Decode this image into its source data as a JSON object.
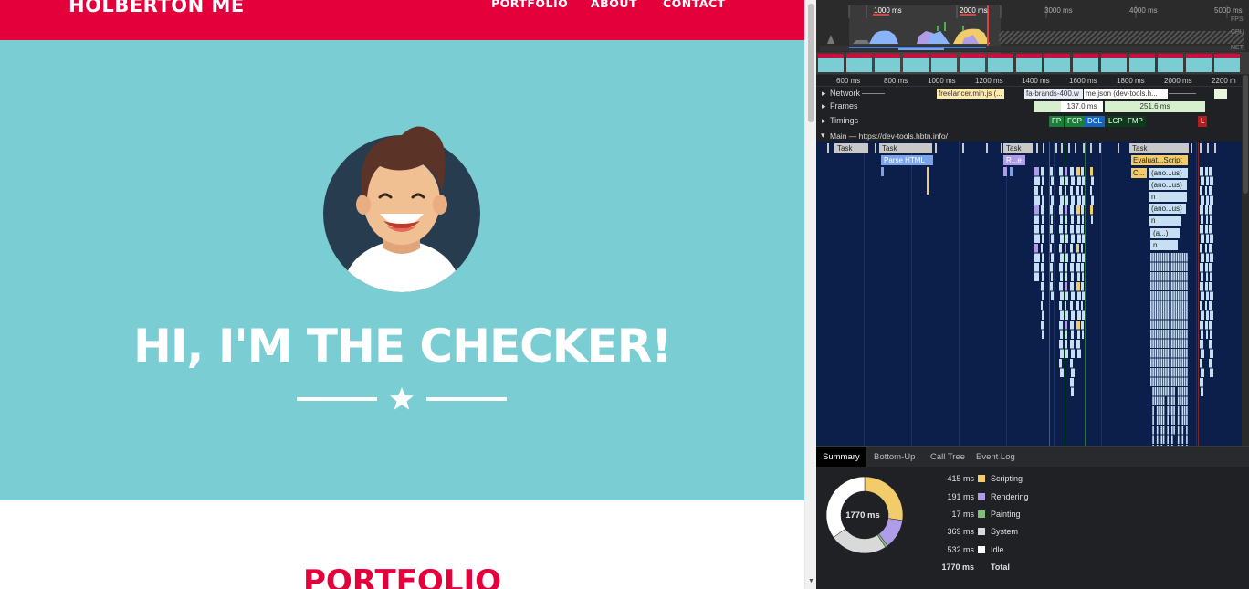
{
  "site": {
    "brand": "HOLBERTON ME",
    "nav": [
      "PORTFOLIO",
      "ABOUT",
      "CONTACT"
    ],
    "hero_title": "HI, I'M THE CHECKER!",
    "portfolio_title": "PORTFOLIO",
    "colors": {
      "nav": "#e4003a",
      "hero": "#7acdd2",
      "accent": "#e4003a"
    }
  },
  "devtools": {
    "overview_ruler": [
      "1000 ms",
      "2000 ms",
      "3000 ms",
      "4000 ms",
      "5000 ms"
    ],
    "overview_lanes": [
      "FPS",
      "CPU",
      "NET"
    ],
    "detail_ruler": [
      "600 ms",
      "800 ms",
      "1000 ms",
      "1200 ms",
      "1400 ms",
      "1600 ms",
      "1800 ms",
      "2000 ms",
      "2200 m"
    ],
    "tracks": {
      "network": "Network",
      "frames": "Frames",
      "timings": "Timings",
      "main": "Main — https://dev-tools.hbtn.info/"
    },
    "network_items": [
      "freelancer.min.js (...",
      "fa-brands-400.w",
      "me.json (dev-tools.h..."
    ],
    "frame_times": [
      "137.0 ms",
      "251.6 ms"
    ],
    "timing_markers": [
      "FP",
      "FCP",
      "DCL",
      "LCP",
      "FMP",
      "L"
    ],
    "flame_labels": {
      "task1": "Task",
      "task2": "Task",
      "task3": "Task",
      "task4": "Task",
      "parse_html": "Parse HTML",
      "recalc": "R...e",
      "evaluate": "Evaluat...Script",
      "compile": "C...",
      "anon1": "(ano...us)",
      "anon2": "(ano...us)",
      "n1": "n",
      "anon3": "(ano...us)",
      "n2": "n",
      "a": "(a...)",
      "n3": "n"
    },
    "tabs": [
      "Summary",
      "Bottom-Up",
      "Call Tree",
      "Event Log"
    ],
    "active_tab": "Summary",
    "summary": {
      "total_center": "1770 ms",
      "rows": [
        {
          "value": "415 ms",
          "label": "Scripting",
          "color": "#f2cb6a"
        },
        {
          "value": "191 ms",
          "label": "Rendering",
          "color": "#af9de8"
        },
        {
          "value": "17 ms",
          "label": "Painting",
          "color": "#7fbf78"
        },
        {
          "value": "369 ms",
          "label": "System",
          "color": "#d9d9d9"
        },
        {
          "value": "532 ms",
          "label": "Idle",
          "color": "#ffffff"
        }
      ],
      "total": {
        "value": "1770 ms",
        "label": "Total"
      }
    }
  }
}
